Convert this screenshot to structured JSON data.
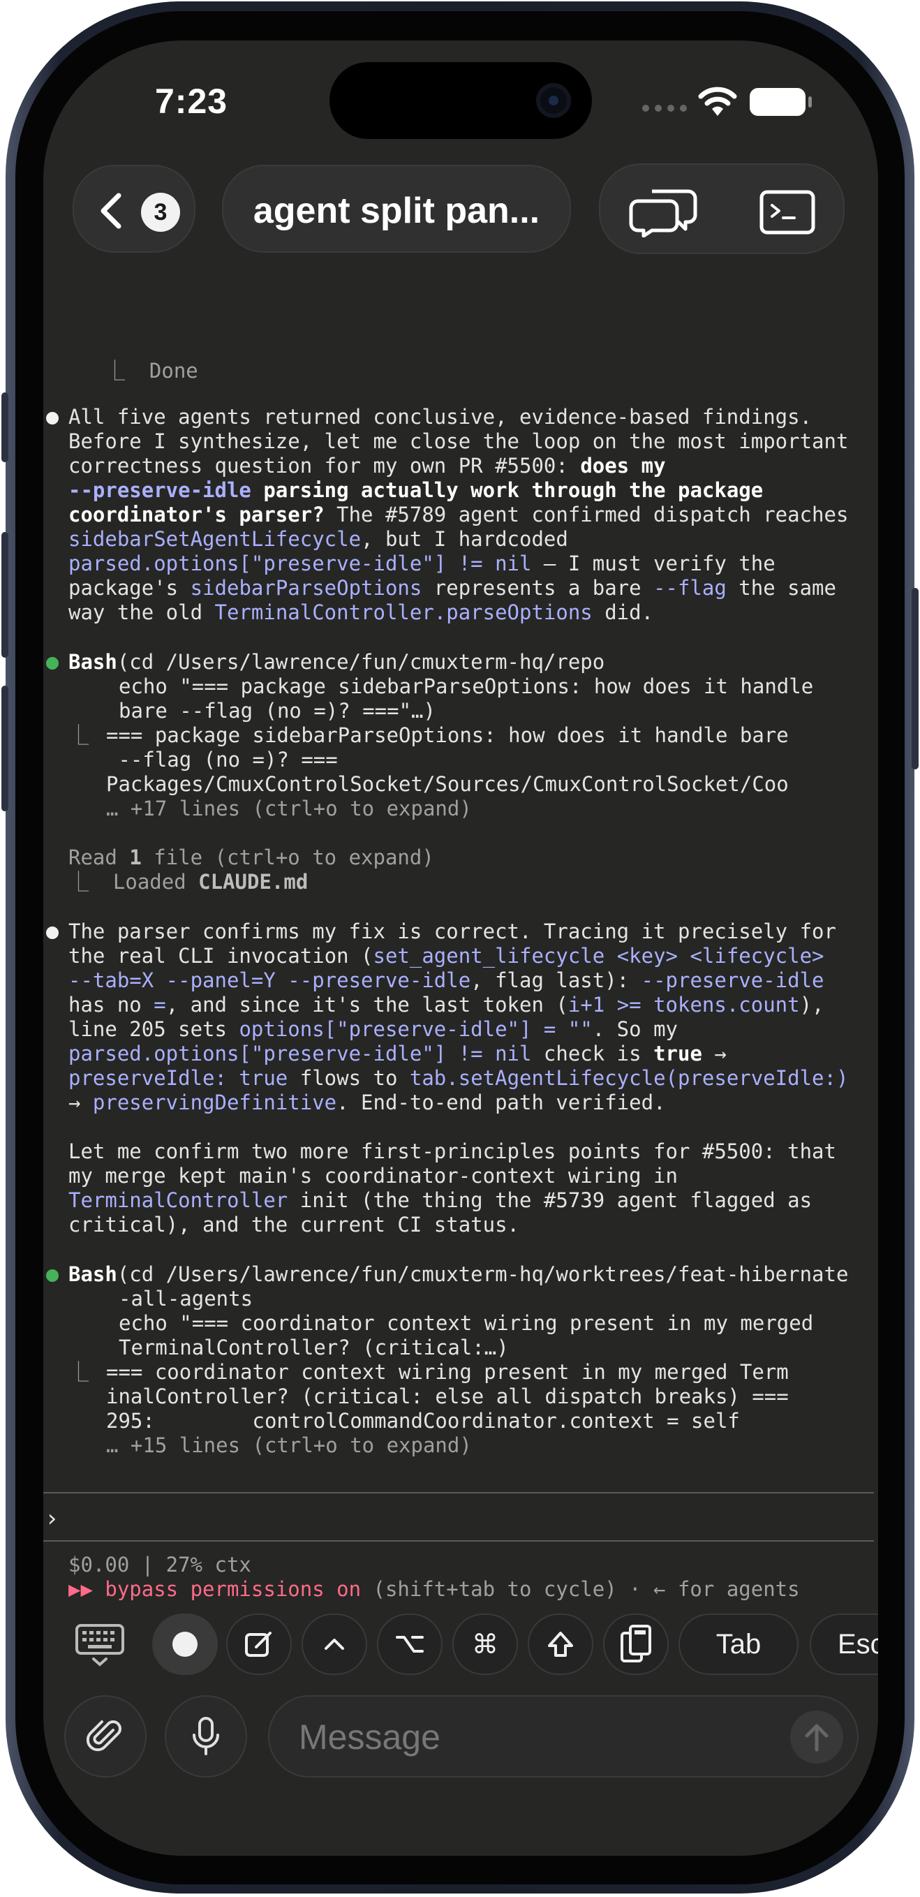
{
  "status_bar": {
    "time": "7:23"
  },
  "nav": {
    "back_count": "3",
    "title": "agent split pan..."
  },
  "terminal": {
    "done_label": "⎿  Done",
    "msg1": {
      "l1": "All five agents returned conclusive, evidence-based findings.",
      "l2": "Before I synthesize, let me close the loop on the most important",
      "l3a": "correctness question for my own PR #5500: ",
      "l3b": "does my",
      "l4a": "--preserve-idle",
      "l4b": " parsing actually work through the package",
      "l5a": "coordinator's parser?",
      "l5b": " The #5789 agent confirmed dispatch reaches",
      "l6a": "sidebarSetAgentLifecycle",
      "l6b": ", but I hardcoded",
      "l7a": "parsed.options[\"preserve-idle\"] != nil",
      "l7b": " — I must verify the",
      "l8a": "package's ",
      "l8b": "sidebarParseOptions",
      "l8c": " represents a bare ",
      "l8d": "--flag",
      "l8e": " the same",
      "l9a": "way the old ",
      "l9b": "TerminalController.parseOptions",
      "l9c": " did."
    },
    "bash1": {
      "tool": "Bash",
      "cmd1": "(cd /Users/lawrence/fun/cmuxterm-hq/repo",
      "cmd2": "echo \"=== package sidebarParseOptions: how does it handle",
      "cmd3": "bare --flag (no =)? ===\"…)",
      "out_prefix": "⎿",
      "out1": "=== package sidebarParseOptions: how does it handle bare",
      "out2": " --flag (no =)? ===",
      "out3": "Packages/CmuxControlSocket/Sources/CmuxControlSocket/Coo",
      "out4": "… +17 lines (ctrl+o to expand)"
    },
    "read": {
      "l1a": "Read ",
      "l1b": "1",
      "l1c": " file (ctrl+o to expand)",
      "l2a": "⎿  Loaded ",
      "l2b": "CLAUDE.md"
    },
    "msg2": {
      "l1": "The parser confirms my fix is correct. Tracing it precisely for",
      "l2a": "the real CLI invocation (",
      "l2b": "set_agent_lifecycle <key> <lifecycle>",
      "l3a": "--tab=X --panel=Y --preserve-idle",
      "l3b": ", flag last): ",
      "l3c": "--preserve-idle",
      "l4a": "has no ",
      "l4b": "=",
      "l4c": ", and since it's the last token (",
      "l4d": "i+1 >= tokens.count",
      "l4e": "),",
      "l5a": "line 205 sets ",
      "l5b": "options[\"preserve-idle\"] = \"\"",
      "l5c": ". So my",
      "l6a": "parsed.options[\"preserve-idle\"] != nil",
      "l6b": " check is ",
      "l6c": "true",
      "l6d": " →",
      "l7a": "preserveIdle: true",
      "l7b": " flows to ",
      "l7c": "tab.setAgentLifecycle(preserveIdle:)",
      "l8a": "→ ",
      "l8b": "preservingDefinitive",
      "l8c": ". End-to-end path verified.",
      "l9": "Let me confirm two more first-principles points for #5500: that",
      "l10": "my merge kept main's coordinator-context wiring in",
      "l11a": "TerminalController",
      "l11b": " init (the thing the #5739 agent flagged as",
      "l12": "critical), and the current CI status."
    },
    "bash2": {
      "tool": "Bash",
      "cmd1": "(cd /Users/lawrence/fun/cmuxterm-hq/worktrees/feat-hibernate",
      "cmd2": "-all-agents",
      "cmd3": "echo \"=== coordinator context wiring present in my merged",
      "cmd4": "TerminalController? (critical:…)",
      "out_prefix": "⎿",
      "out1": "=== coordinator context wiring present in my merged Term",
      "out2": "inalController? (critical: else all dispatch breaks) ===",
      "out3": "295:        controlCommandCoordinator.context = self",
      "out4": "… +15 lines (ctrl+o to expand)"
    },
    "prompt_char": "›",
    "footer": {
      "cost": "$0.00 | 27% ctx",
      "mode_icon": "▶▶",
      "mode": " bypass permissions on",
      "hint": " (shift+tab to cycle) · ← for agents"
    }
  },
  "toolbar": {
    "icons": [
      "keyboard-icon",
      "record-icon",
      "compose-icon",
      "ctrl-caret-icon",
      "option-icon",
      "command-icon",
      "shift-icon",
      "paste-icon"
    ],
    "tab_label": "Tab",
    "esc_label": "Esc"
  },
  "composer": {
    "placeholder": "Message"
  },
  "colors": {
    "background": "#262624",
    "code_accent": "#aab0ff",
    "success": "#46b35a",
    "danger": "#ff6b88"
  }
}
